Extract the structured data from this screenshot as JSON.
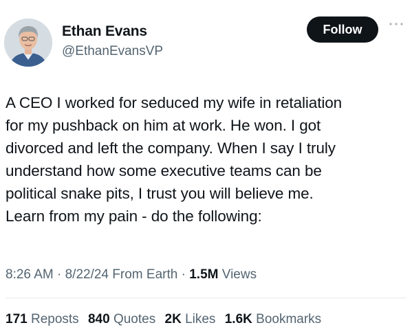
{
  "author": {
    "name": "Ethan Evans",
    "handle": "@EthanEvansVP",
    "avatar_icon": "profile-photo"
  },
  "follow_label": "Follow",
  "more_icon": "more-dots-icon",
  "post": {
    "lines": [
      "A CEO I worked for seduced my wife in retaliation",
      "for my pushback on him at work. He won. I got",
      "divorced and left the company. When I say I truly",
      "understand how some executive teams can be",
      "political snake pits, I trust you will believe me.",
      "Learn from my pain - do the following:"
    ]
  },
  "meta": {
    "time": "8:26 AM",
    "sep1": " · ",
    "date": "8/22/24",
    "source": " From Earth",
    "sep2": " · ",
    "views_count": "1.5M",
    "views_label": " Views"
  },
  "stats": {
    "reposts_count": "171",
    "reposts_label": "Reposts",
    "quotes_count": "840",
    "quotes_label": "Quotes",
    "likes_count": "2K",
    "likes_label": "Likes",
    "bookmarks_count": "1.6K",
    "bookmarks_label": "Bookmarks"
  },
  "colors": {
    "text": "#0f1419",
    "secondary": "#536471",
    "button_bg": "#0f1419",
    "divider": "#e6e9eb"
  }
}
